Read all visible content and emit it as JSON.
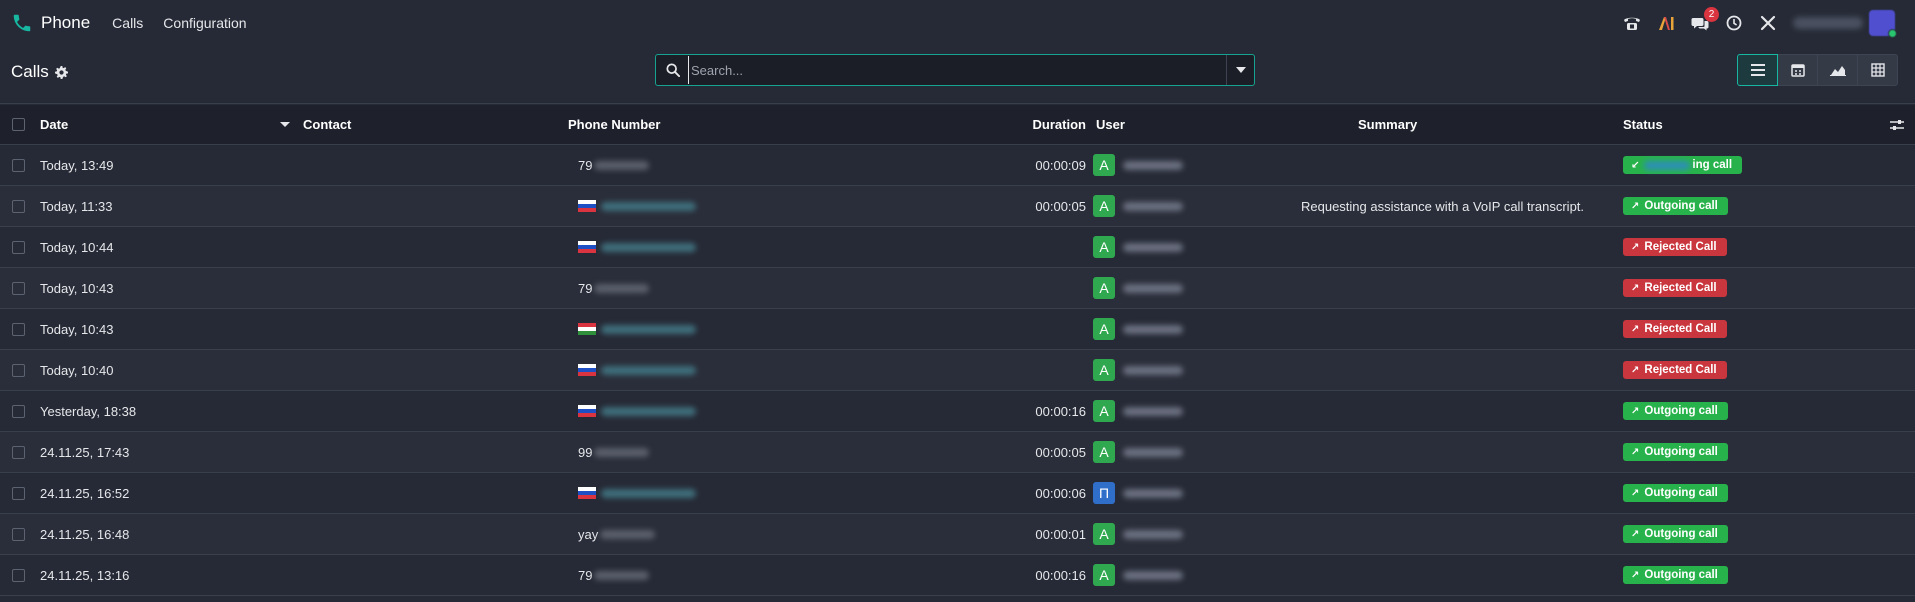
{
  "app": {
    "name": "Phone",
    "menu": [
      "Calls",
      "Configuration"
    ],
    "notification_count": "2"
  },
  "control": {
    "breadcrumb": "Calls",
    "search_placeholder": "Search..."
  },
  "table": {
    "columns": {
      "date": "Date",
      "contact": "Contact",
      "phone": "Phone Number",
      "duration": "Duration",
      "user": "User",
      "summary": "Summary",
      "status": "Status"
    },
    "rows": [
      {
        "date": "Today, 13:49",
        "contact": "",
        "phone_prefix": "79",
        "flag": "",
        "duration": "00:00:09",
        "user_initial": "A",
        "summary": "",
        "status": "ing call",
        "status_kind": "incoming"
      },
      {
        "date": "Today, 11:33",
        "contact": "",
        "phone_prefix": "",
        "flag": "ru",
        "duration": "00:00:05",
        "user_initial": "A",
        "summary": "Requesting assistance with a VoIP call transcript.",
        "status": "Outgoing call",
        "status_kind": "outgoing"
      },
      {
        "date": "Today, 10:44",
        "contact": "",
        "phone_prefix": "",
        "flag": "ru",
        "duration": "",
        "user_initial": "A",
        "summary": "",
        "status": "Rejected Call",
        "status_kind": "rejected"
      },
      {
        "date": "Today, 10:43",
        "contact": "",
        "phone_prefix": "79",
        "flag": "",
        "duration": "",
        "user_initial": "A",
        "summary": "",
        "status": "Rejected Call",
        "status_kind": "rejected"
      },
      {
        "date": "Today, 10:43",
        "contact": "",
        "phone_prefix": "",
        "flag": "hu",
        "duration": "",
        "user_initial": "A",
        "summary": "",
        "status": "Rejected Call",
        "status_kind": "rejected"
      },
      {
        "date": "Today, 10:40",
        "contact": "",
        "phone_prefix": "",
        "flag": "ru",
        "duration": "",
        "user_initial": "A",
        "summary": "",
        "status": "Rejected Call",
        "status_kind": "rejected"
      },
      {
        "date": "Yesterday, 18:38",
        "contact": "",
        "phone_prefix": "",
        "flag": "ru",
        "duration": "00:00:16",
        "user_initial": "A",
        "summary": "",
        "status": "Outgoing call",
        "status_kind": "outgoing"
      },
      {
        "date": "24.11.25, 17:43",
        "contact": "",
        "phone_prefix": "99",
        "flag": "",
        "duration": "00:00:05",
        "user_initial": "A",
        "summary": "",
        "status": "Outgoing call",
        "status_kind": "outgoing"
      },
      {
        "date": "24.11.25, 16:52",
        "contact": "",
        "phone_prefix": "",
        "flag": "ru",
        "duration": "00:00:06",
        "user_initial": "П",
        "summary": "",
        "status": "Outgoing call",
        "status_kind": "outgoing"
      },
      {
        "date": "24.11.25, 16:48",
        "contact": "",
        "phone_prefix": "yay",
        "flag": "",
        "duration": "00:00:01",
        "user_initial": "A",
        "summary": "",
        "status": "Outgoing call",
        "status_kind": "outgoing"
      },
      {
        "date": "24.11.25, 13:16",
        "contact": "",
        "phone_prefix": "79",
        "flag": "",
        "duration": "00:00:16",
        "user_initial": "A",
        "summary": "",
        "status": "Outgoing call",
        "status_kind": "outgoing"
      }
    ]
  },
  "colors": {
    "accent": "#17b7a2",
    "outgoing": "#28b24b",
    "rejected": "#c9363e",
    "avatar_a": "#2fa84f",
    "avatar_p": "#2f6fc9"
  }
}
